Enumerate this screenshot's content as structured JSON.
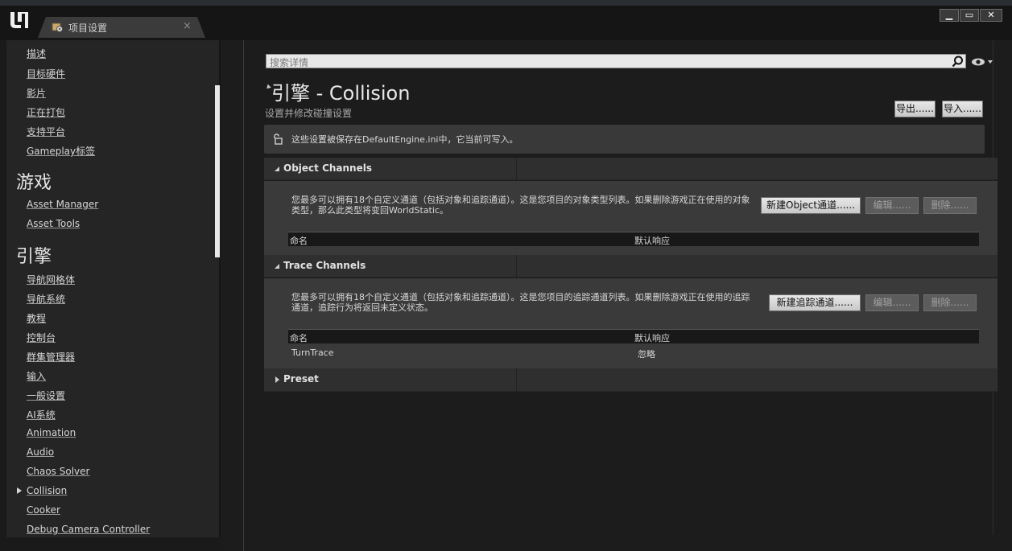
{
  "window": {
    "tab_label": "项目设置",
    "tab_close": "×",
    "minimize": "▁",
    "maximize": "▭",
    "close": "✕"
  },
  "sidebar": {
    "items_top": [
      {
        "label": "描述"
      },
      {
        "label": "目标硬件"
      },
      {
        "label": "影片"
      },
      {
        "label": "正在打包"
      },
      {
        "label": "支持平台"
      },
      {
        "label": "Gameplay标签"
      }
    ],
    "heading_game": "游戏",
    "items_game": [
      {
        "label": "Asset Manager"
      },
      {
        "label": "Asset Tools"
      }
    ],
    "heading_engine": "引擎",
    "items_engine": [
      {
        "label": "导航网格体"
      },
      {
        "label": "导航系统"
      },
      {
        "label": "教程"
      },
      {
        "label": "控制台"
      },
      {
        "label": "群集管理器"
      },
      {
        "label": "输入"
      },
      {
        "label": "一般设置"
      },
      {
        "label": "AI系统"
      },
      {
        "label": "Animation"
      },
      {
        "label": "Audio"
      },
      {
        "label": "Chaos Solver"
      },
      {
        "label": "Collision"
      },
      {
        "label": "Cooker"
      },
      {
        "label": "Debug Camera Controller"
      }
    ]
  },
  "search": {
    "placeholder": "搜索详情"
  },
  "header": {
    "title": "引擎 - Collision",
    "subtitle": "设置并修改碰撞设置",
    "export_label": "导出......",
    "import_label": "导入......"
  },
  "notice": {
    "text": "这些设置被保存在DefaultEngine.ini中，它当前可写入。"
  },
  "object_channels": {
    "title": "Object Channels",
    "description": "您最多可以拥有18个自定义通道（包括对象和追踪通道）。这是您项目的对象类型列表。如果删除游戏正在使用的对象类型，那么此类型将变回WorldStatic。",
    "new_label": "新建Object通道......",
    "edit_label": "编辑......",
    "delete_label": "删除......",
    "columns": [
      "命名",
      "默认响应"
    ],
    "rows": []
  },
  "trace_channels": {
    "title": "Trace Channels",
    "description": "您最多可以拥有18个自定义通道（包括对象和追踪通道）。这是您项目的追踪通道列表。如果删除游戏正在使用的追踪通道，追踪行为将返回未定义状态。",
    "new_label": "新建追踪通道......",
    "edit_label": "编辑......",
    "delete_label": "删除......",
    "columns": [
      "命名",
      "默认响应"
    ],
    "rows": [
      {
        "name": "TurnTrace",
        "response": "忽略"
      }
    ]
  },
  "preset": {
    "title": "Preset"
  }
}
